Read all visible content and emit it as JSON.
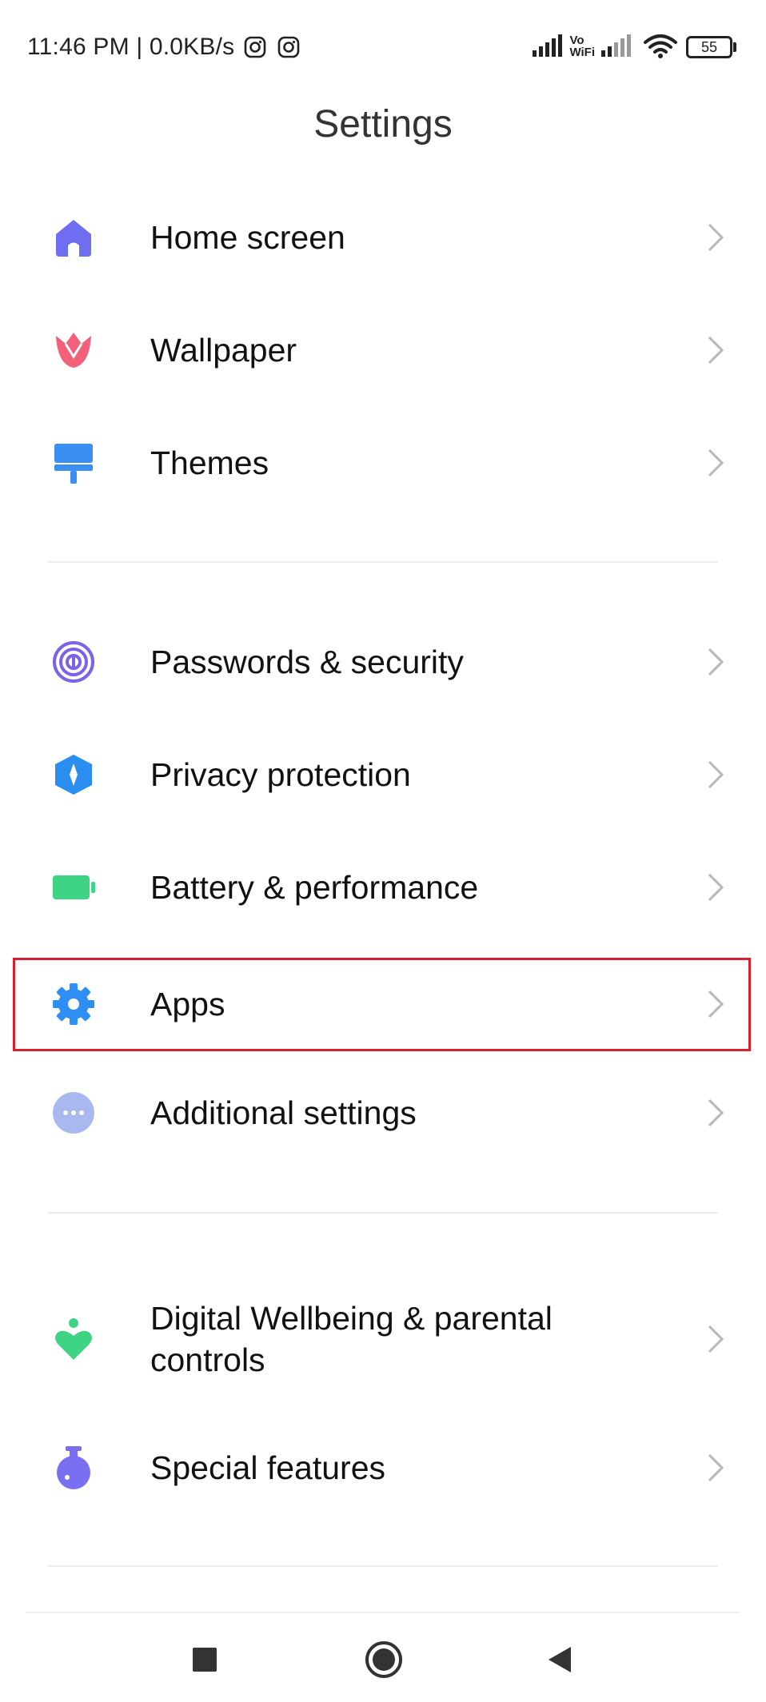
{
  "status_bar": {
    "time_text": "11:46 PM | 0.0KB/s",
    "notification_icons": [
      "instagram-icon",
      "instagram-icon"
    ],
    "vowifi_line1": "Vo",
    "vowifi_line2": "WiFi",
    "battery_level": "55"
  },
  "header": {
    "title": "Settings"
  },
  "sections": [
    {
      "items": [
        {
          "label": "Home screen",
          "icon": "home-icon",
          "color": "#6f6df0"
        },
        {
          "label": "Wallpaper",
          "icon": "tulip-icon",
          "color": "#f2607a"
        },
        {
          "label": "Themes",
          "icon": "paint-roller-icon",
          "color": "#3b8ff2"
        }
      ]
    },
    {
      "items": [
        {
          "label": "Passwords & security",
          "icon": "fingerprint-icon",
          "color": "#7a63e8"
        },
        {
          "label": "Privacy protection",
          "icon": "privacy-shield-icon",
          "color": "#2a8ef0"
        },
        {
          "label": "Battery & performance",
          "icon": "battery-icon",
          "color": "#3fd483"
        },
        {
          "label": "Apps",
          "icon": "gear-icon",
          "color": "#2f8ef2",
          "highlighted": true
        },
        {
          "label": "Additional settings",
          "icon": "more-dots-icon",
          "color": "#a9b8ef"
        }
      ]
    },
    {
      "items": [
        {
          "label": "Digital Wellbeing & parental",
          "label_line2": "controls",
          "icon": "wellbeing-icon",
          "color": "#3fd483"
        },
        {
          "label": "Special features",
          "icon": "flask-icon",
          "color": "#7a6ff0"
        }
      ]
    }
  ],
  "nav_bar": {
    "buttons": [
      "recents-button",
      "home-button",
      "back-button"
    ]
  },
  "colors": {
    "highlight_border": "#d9202f",
    "chevron": "#b8b8b8",
    "divider": "#ececec"
  }
}
